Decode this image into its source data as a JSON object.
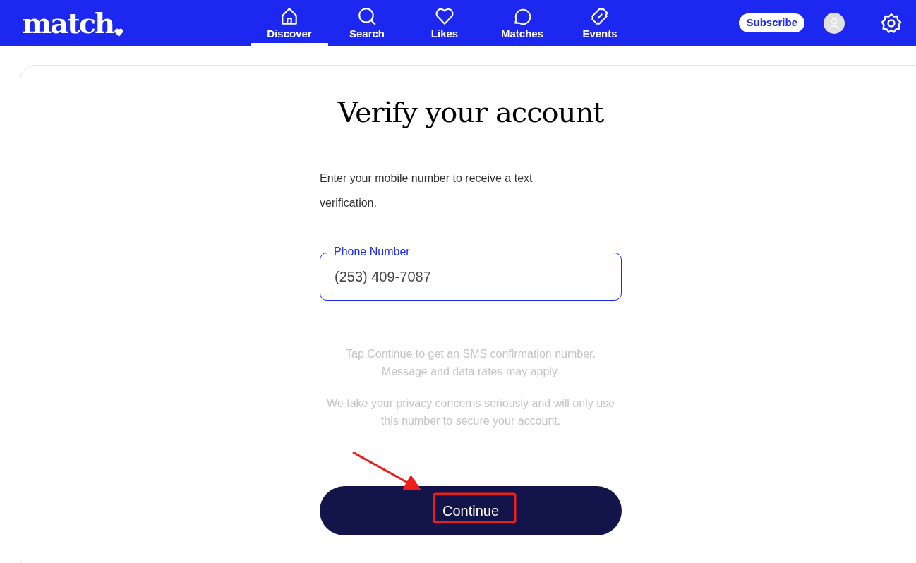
{
  "header": {
    "logo": "match",
    "nav": [
      {
        "label": "Discover",
        "selected": true
      },
      {
        "label": "Search",
        "selected": false
      },
      {
        "label": "Likes",
        "selected": false
      },
      {
        "label": "Matches",
        "selected": false
      },
      {
        "label": "Events",
        "selected": false
      }
    ],
    "subscribe": "Subscribe"
  },
  "card": {
    "title": "Verify your account",
    "intro": "Enter your mobile number to receive a text verification.",
    "phone_field": {
      "label": "Phone Number",
      "value": "(253) 409-7087"
    },
    "notes": [
      "Tap Continue to get an SMS confirmation number. Message and data rates may apply.",
      "We take your privacy concerns seriously and will only use this number to secure your account."
    ],
    "continue_button": "Continue"
  }
}
